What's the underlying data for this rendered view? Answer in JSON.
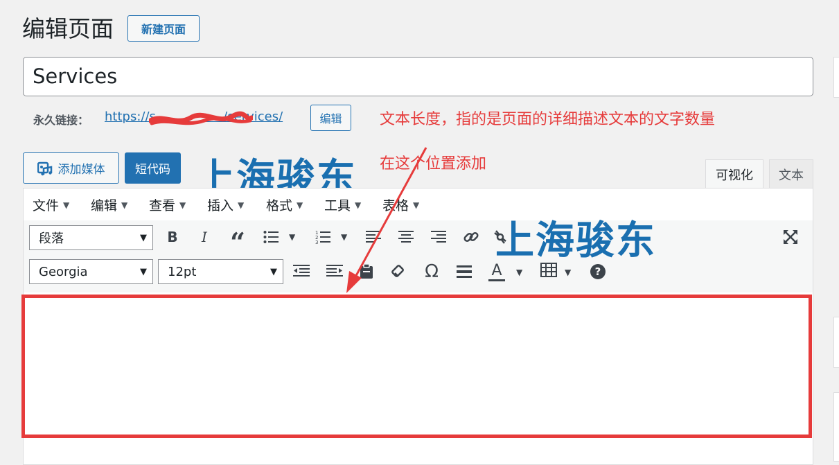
{
  "header": {
    "title": "编辑页面",
    "new_button": "新建页面"
  },
  "post_title": {
    "value": "Services"
  },
  "permalink": {
    "label": "永久链接：",
    "url": "https://s                 /services/",
    "edit_button": "编辑"
  },
  "annotations": {
    "note_length": "文本长度，指的是页面的详细描述文本的文字数量",
    "note_position": "在这个位置添加",
    "watermark": "上海骏东",
    "highlight_color": "#e63b3b"
  },
  "media_buttons": {
    "add_media": "添加媒体",
    "shortcode": "短代码"
  },
  "editor_tabs": {
    "visual": "可视化",
    "text": "文本"
  },
  "menubar": [
    "文件",
    "编辑",
    "查看",
    "插入",
    "格式",
    "工具",
    "表格"
  ],
  "toolbar": {
    "format_select": "段落",
    "font_select": "Georgia",
    "size_select": "12pt",
    "row1_icons": [
      "bold-icon",
      "italic-icon",
      "blockquote-icon",
      "bullet-list-icon",
      "numbered-list-icon",
      "align-left-icon",
      "align-center-icon",
      "align-right-icon",
      "link-icon",
      "unlink-icon",
      "fullscreen-icon"
    ],
    "row2_icons": [
      "outdent-icon",
      "indent-icon",
      "paste-text-icon",
      "clear-formatting-icon",
      "special-character-icon",
      "horizontal-rule-icon",
      "text-color-icon",
      "table-icon",
      "help-icon"
    ],
    "glyphs": {
      "bold": "B",
      "italic": "I",
      "quote": "“",
      "omega": "Ω",
      "color": "A",
      "help": "?"
    }
  },
  "colors": {
    "accent": "#2271b1",
    "watermark": "#1a6fb0",
    "annotation": "#e63b3b"
  }
}
